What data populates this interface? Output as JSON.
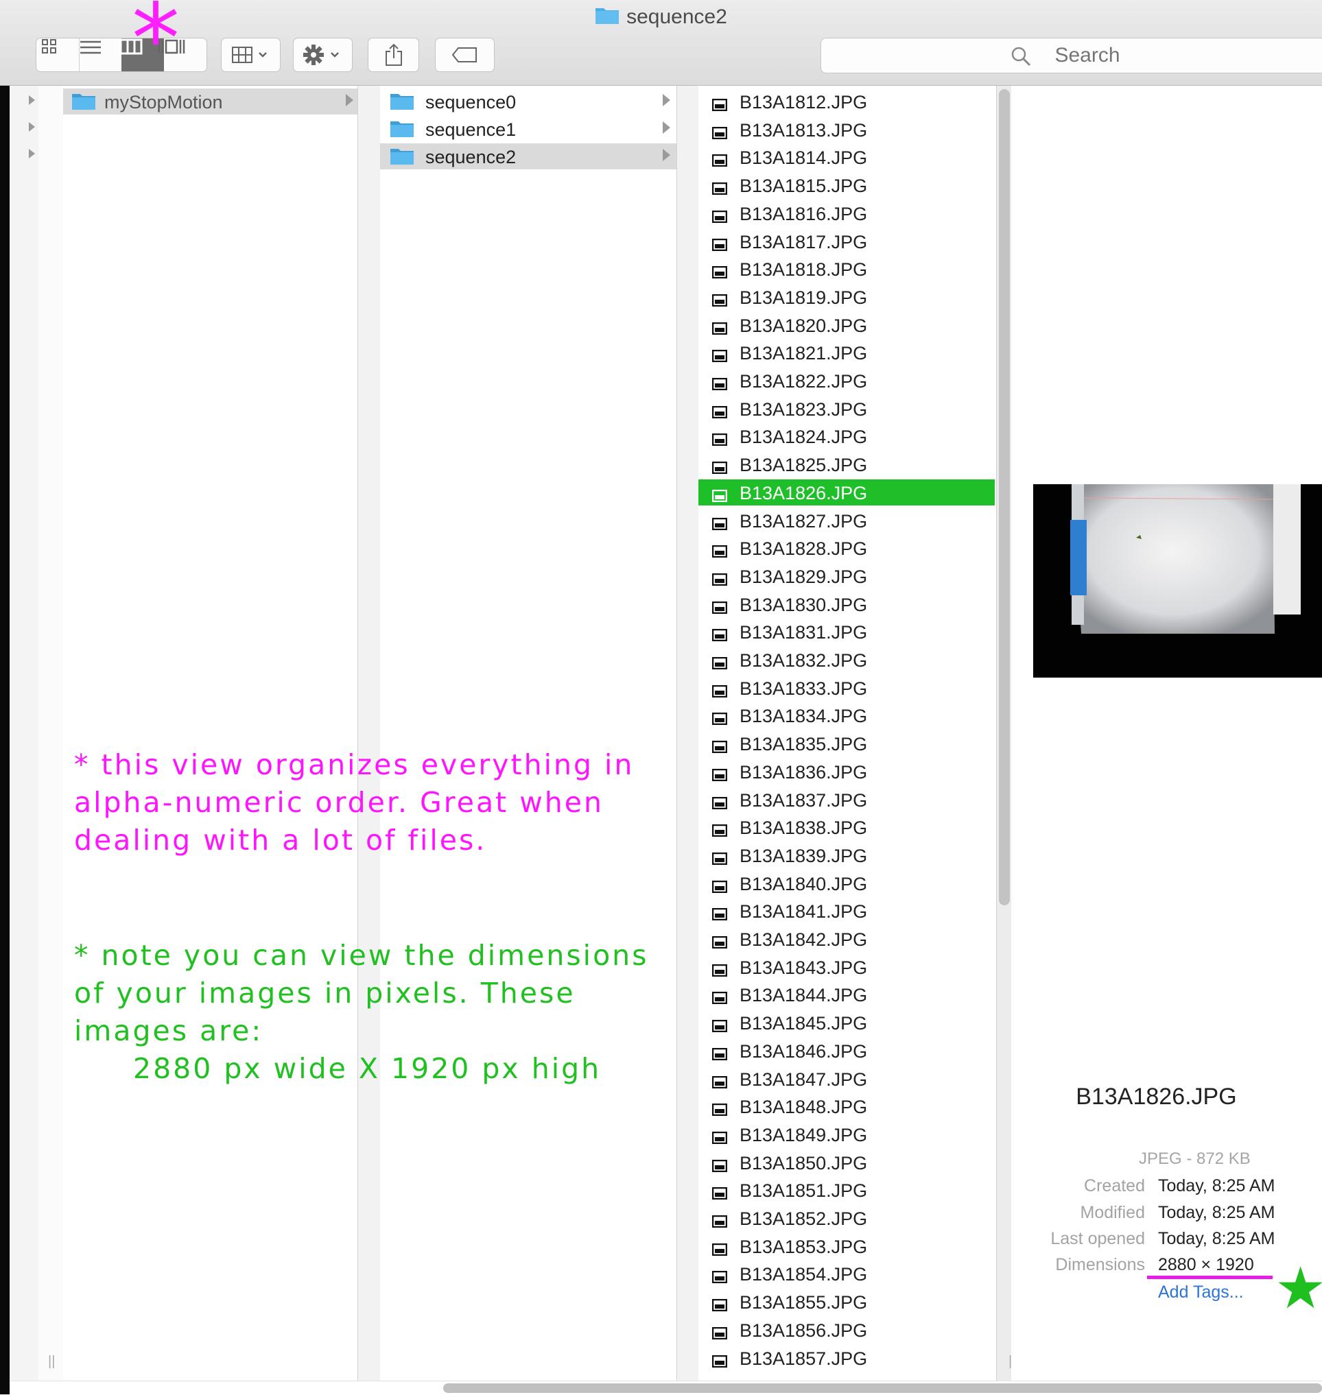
{
  "window": {
    "title": "sequence2"
  },
  "toolbar": {
    "view_buttons": [
      "icon-view",
      "list-view",
      "column-view",
      "gallery-view"
    ],
    "selected_view": "column-view",
    "arrange_icon": "arrange-grid-icon",
    "action_icon": "gear-icon",
    "share_icon": "share-icon",
    "tag_icon": "tag-icon"
  },
  "search": {
    "placeholder": "Search"
  },
  "columns": {
    "col2": {
      "items": [
        {
          "label": "myStopMotion",
          "selected": true
        }
      ]
    },
    "col3": {
      "items": [
        {
          "label": "sequence0",
          "selected": false
        },
        {
          "label": "sequence1",
          "selected": false
        },
        {
          "label": "sequence2",
          "selected": true
        }
      ]
    },
    "files": [
      "B13A1812.JPG",
      "B13A1813.JPG",
      "B13A1814.JPG",
      "B13A1815.JPG",
      "B13A1816.JPG",
      "B13A1817.JPG",
      "B13A1818.JPG",
      "B13A1819.JPG",
      "B13A1820.JPG",
      "B13A1821.JPG",
      "B13A1822.JPG",
      "B13A1823.JPG",
      "B13A1824.JPG",
      "B13A1825.JPG",
      "B13A1826.JPG",
      "B13A1827.JPG",
      "B13A1828.JPG",
      "B13A1829.JPG",
      "B13A1830.JPG",
      "B13A1831.JPG",
      "B13A1832.JPG",
      "B13A1833.JPG",
      "B13A1834.JPG",
      "B13A1835.JPG",
      "B13A1836.JPG",
      "B13A1837.JPG",
      "B13A1838.JPG",
      "B13A1839.JPG",
      "B13A1840.JPG",
      "B13A1841.JPG",
      "B13A1842.JPG",
      "B13A1843.JPG",
      "B13A1844.JPG",
      "B13A1845.JPG",
      "B13A1846.JPG",
      "B13A1847.JPG",
      "B13A1848.JPG",
      "B13A1849.JPG",
      "B13A1850.JPG",
      "B13A1851.JPG",
      "B13A1852.JPG",
      "B13A1853.JPG",
      "B13A1854.JPG",
      "B13A1855.JPG",
      "B13A1856.JPG",
      "B13A1857.JPG"
    ],
    "selected_file": "B13A1826.JPG"
  },
  "preview": {
    "filename": "B13A1826.JPG",
    "kind": "JPEG - 872 KB",
    "meta": [
      {
        "key": "Created",
        "value": "Today, 8:25 AM"
      },
      {
        "key": "Modified",
        "value": "Today, 8:25 AM"
      },
      {
        "key": "Last opened",
        "value": "Today, 8:25 AM"
      },
      {
        "key": "Dimensions",
        "value": "2880 × 1920"
      }
    ],
    "add_tags": "Add Tags..."
  },
  "annotations": {
    "note1": [
      "* this view organizes everything in",
      "alpha-numeric order. Great when",
      "dealing with a lot of files."
    ],
    "note2": [
      "* note you can view the dimensions",
      "of your images in pixels. These",
      "images are:"
    ],
    "note2_size": "2880 px wide X 1920 px high",
    "pink_star": "*",
    "green_star": "★"
  },
  "colors": {
    "selection_green": "#1fbf2a",
    "annotation_pink": "#ff14ff",
    "annotation_green": "#20c020",
    "folder_blue": "#4aaee6",
    "link_blue": "#2b74d9"
  }
}
